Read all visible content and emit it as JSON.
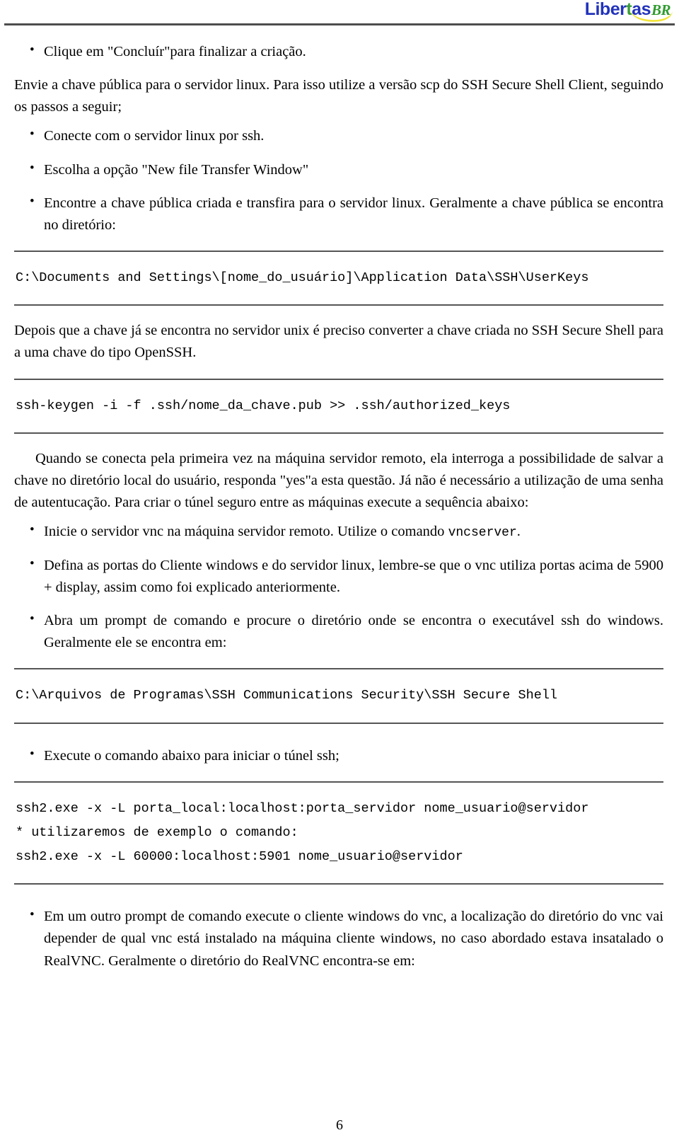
{
  "header": {
    "logo_main": "Libertas",
    "logo_main_green_letter": "t",
    "logo_suffix": "BR",
    "brand_blue": "#2233bb",
    "brand_green": "#2e9b2e",
    "brand_yellow": "#f2e43a",
    "rule_color": "#4d4d4d"
  },
  "blocks": {
    "bullet_concluir": "Clique em \"Concluír\"para finalizar a criação.",
    "par_envie": "Envie a chave pública para o servidor linux. Para isso utilize a versão scp do SSH Secure Shell Client, seguindo os passos a seguir;",
    "bullet_conecte": "Conecte com o servidor linux por ssh.",
    "bullet_escolha": "Escolha a opção \"New file Transfer Window\"",
    "bullet_encontre": "Encontre a chave pública criada e transfira para o servidor linux. Geralmente a chave pública se encontra no diretório:",
    "code_userkeys": "C:\\Documents and Settings\\[nome_do_usuário]\\Application Data\\SSH\\UserKeys",
    "par_depois": "Depois que a chave já se encontra no servidor unix é preciso converter a chave criada no SSH Secure Shell para a uma chave do tipo OpenSSH.",
    "code_sshkeygen": "ssh-keygen -i -f .ssh/nome_da_chave.pub >> .ssh/authorized_keys",
    "par_quando": "Quando se conecta pela primeira vez na máquina servidor remoto, ela interroga a possibilidade de salvar a chave no diretório local do usuário, responda \"yes\"a esta questão. Já não é necessário a utilização de uma senha de autentucação. Para criar o túnel seguro entre as máquinas execute a sequência abaixo:",
    "bullet_inicie_pre": "Inicie o servidor vnc na máquina servidor remoto. Utilize o comando ",
    "bullet_inicie_mono": "vncserver",
    "bullet_inicie_post": ".",
    "bullet_defina": "Defina as portas do Cliente windows e do servidor linux, lembre-se que o vnc utiliza portas acima de 5900 + display, assim como foi explicado anteriormente.",
    "bullet_abra": "Abra um prompt de comando e procure o diretório onde se encontra o executável ssh do windows. Geralmente ele se encontra em:",
    "code_secureshell": "C:\\Arquivos de Programas\\SSH Communications Security\\SSH Secure Shell",
    "bullet_execute": "Execute o comando abaixo para iniciar o túnel ssh;",
    "code_ssh2_line1": "ssh2.exe -x -L porta_local:localhost:porta_servidor nome_usuario@servidor",
    "code_ssh2_line2": "* utilizaremos de exemplo o comando:",
    "code_ssh2_line3": "ssh2.exe -x -L 60000:localhost:5901 nome_usuario@servidor",
    "bullet_emumoutro": "Em um outro prompt de comando execute o cliente windows do vnc, a localização do diretório do vnc vai depender de qual vnc está instalado na máquina cliente windows, no caso abordado estava insatalado o RealVNC. Geralmente o diretório do RealVNC encontra-se em:"
  },
  "footer": {
    "page_number": "6"
  }
}
